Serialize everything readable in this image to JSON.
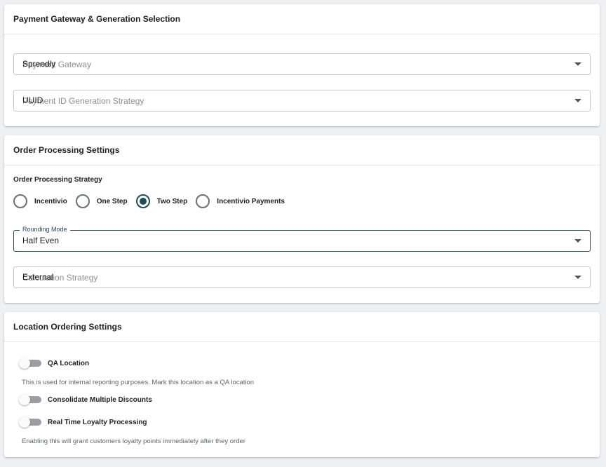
{
  "payment_card": {
    "title": "Payment Gateway & Generation Selection",
    "gateway": {
      "placeholder": "Payment Gateway",
      "value": "Spreedly"
    },
    "id_strategy": {
      "placeholder": "Payment ID Generation Strategy",
      "value": "UUID"
    }
  },
  "order_card": {
    "title": "Order Processing Settings",
    "strategy_label": "Order Processing Strategy",
    "radios": [
      {
        "label": "Incentivio",
        "checked": false
      },
      {
        "label": "One Step",
        "checked": false
      },
      {
        "label": "Two Step",
        "checked": true
      },
      {
        "label": "Incentivio Payments",
        "checked": false
      }
    ],
    "rounding": {
      "label": "Rounding Mode",
      "value": "Half Even"
    },
    "calc_strategy": {
      "placeholder": "Calculation Strategy",
      "value": "External"
    }
  },
  "location_card": {
    "title": "Location Ordering Settings",
    "qa_location": {
      "label": "QA Location",
      "on": false,
      "helper": "This is used for internal reporting purposes. Mark this location as a QA location"
    },
    "consolidate": {
      "label": "Consolidate Multiple Discounts",
      "on": false
    },
    "loyalty": {
      "label": "Real Time Loyalty Processing",
      "on": false,
      "helper": "Enabling this will grant customers loyalty points immediately after they order"
    }
  },
  "colors": {
    "accent": "#1f4a5c",
    "background": "#eef0f3"
  }
}
